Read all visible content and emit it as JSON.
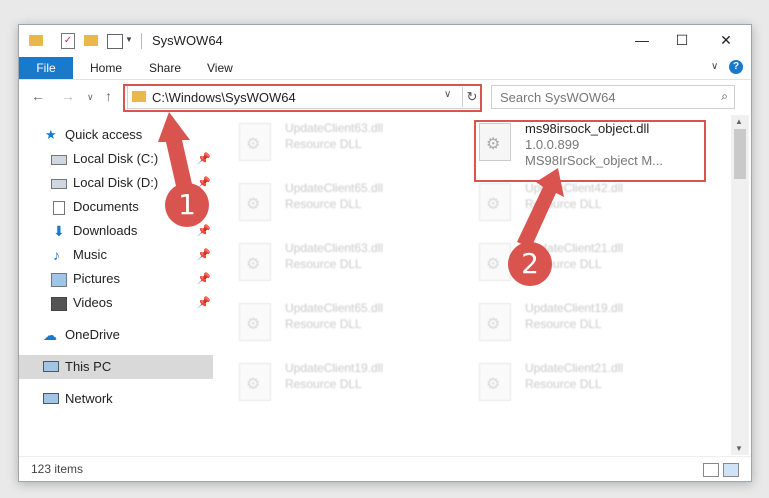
{
  "window": {
    "title": "SysWOW64"
  },
  "ribbon": {
    "tabs": [
      "File",
      "Home",
      "Share",
      "View"
    ],
    "help": "?"
  },
  "nav": {
    "address": "C:\\Windows\\SysWOW64",
    "search_placeholder": "Search SysWOW64"
  },
  "sidebar": {
    "items": [
      {
        "label": "Quick access"
      },
      {
        "label": "Local Disk (C:)"
      },
      {
        "label": "Local Disk (D:)"
      },
      {
        "label": "Documents"
      },
      {
        "label": "Downloads"
      },
      {
        "label": "Music"
      },
      {
        "label": "Pictures"
      },
      {
        "label": "Videos"
      },
      {
        "label": "OneDrive"
      },
      {
        "label": "This PC"
      },
      {
        "label": "Network"
      }
    ]
  },
  "files": {
    "left": [
      {
        "name": "UpdateClient63.dll",
        "type": "Resource DLL"
      },
      {
        "name": "UpdateClient65.dll",
        "type": "Resource DLL"
      },
      {
        "name": "UpdateClient63.dll",
        "type": "Resource DLL"
      },
      {
        "name": "UpdateClient65.dll",
        "type": "Resource DLL"
      },
      {
        "name": "UpdateClient19.dll",
        "type": "Resource DLL"
      }
    ],
    "right": [
      {
        "name": "UpdateClient42.dll",
        "type": "Resource DLL"
      },
      {
        "name": "UpdateClient21.dll",
        "type": "Resource DLL"
      },
      {
        "name": "UpdateClient19.dll",
        "type": "Resource DLL"
      },
      {
        "name": "UpdateClient21.dll",
        "type": "Resource DLL"
      }
    ],
    "selected": {
      "name": "ms98irsock_object.dll",
      "version": "1.0.0.899",
      "desc": "MS98IrSock_object M..."
    }
  },
  "status": {
    "count": "123 items"
  },
  "annotations": {
    "step1": "1",
    "step2": "2"
  },
  "colors": {
    "accent": "#1979ca",
    "highlight": "#d9534f",
    "folder": "#e8b84a"
  }
}
